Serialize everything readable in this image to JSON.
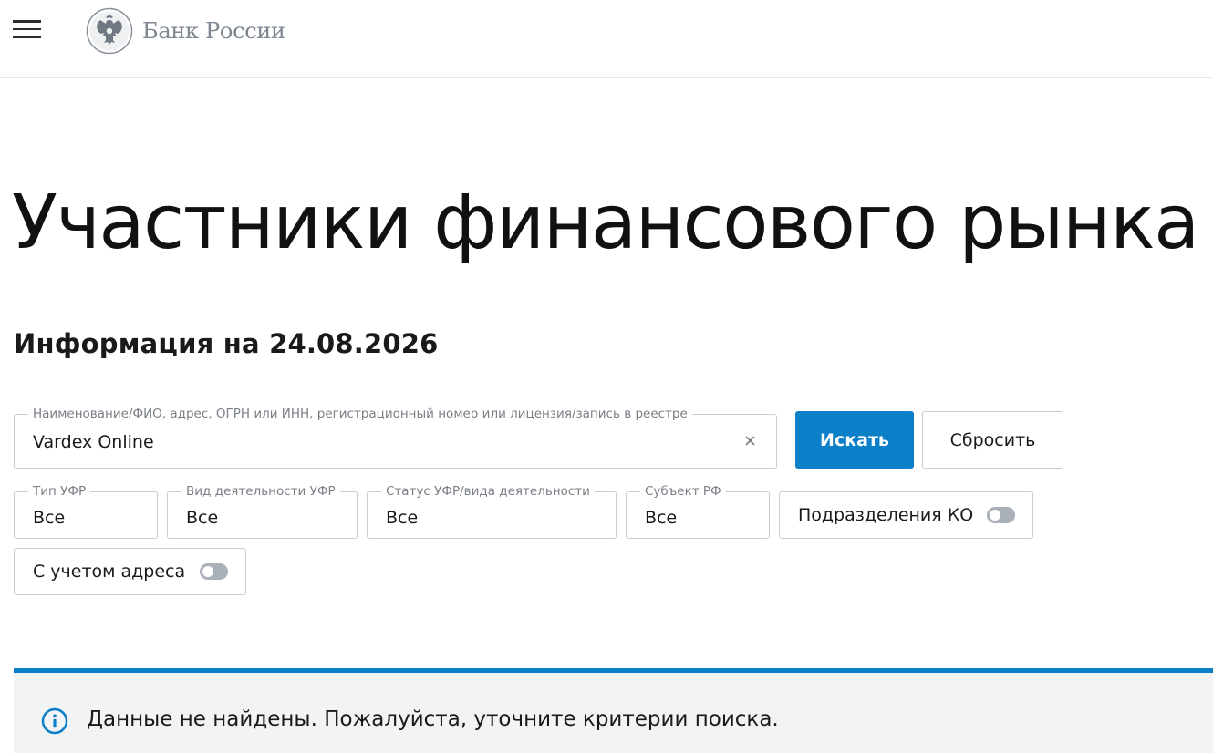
{
  "header": {
    "brand": "Банк России"
  },
  "page": {
    "title": "Участники финансового рынка",
    "info_date": "Информация на 24.08.2026"
  },
  "search": {
    "legend": "Наименование/ФИО, адрес, ОГРН или ИНН, регистрационный номер или лицензия/запись в реестре",
    "value": "Vardex Online",
    "clear_symbol": "×",
    "search_button": "Искать",
    "reset_button": "Сбросить"
  },
  "filters": {
    "type": {
      "legend": "Тип УФР",
      "value": "Все"
    },
    "activity": {
      "legend": "Вид деятельности УФР",
      "value": "Все"
    },
    "status": {
      "legend": "Статус УФР/вида деятельности",
      "value": "Все"
    },
    "region": {
      "legend": "Субъект РФ",
      "value": "Все"
    },
    "subdivisions": {
      "label": "Подразделения КО",
      "on": false
    },
    "with_address": {
      "label": "С учетом адреса",
      "on": false
    }
  },
  "alert": {
    "message": "Данные не найдены. Пожалуйста, уточните критерии поиска."
  },
  "colors": {
    "accent": "#0b7fc7",
    "alert_bg": "#f2f3f4",
    "border": "#c9ccd1",
    "muted_text": "#7a7f86"
  },
  "icons": {
    "menu": "hamburger-menu-icon",
    "logo": "double-headed-eagle-emblem",
    "alert": "info-circle-icon"
  }
}
